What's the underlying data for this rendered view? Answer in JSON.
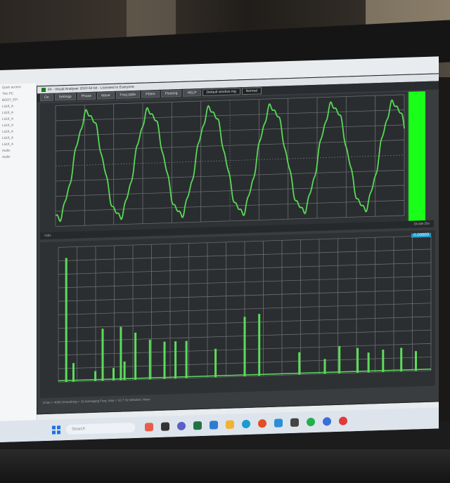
{
  "window": {
    "title": "64 - Visual Analyser 2020 64 bit - Licensed to Everyone"
  },
  "toolbar": {
    "buttons": [
      "On",
      "Settings",
      "Phase",
      "Wave",
      "Freq.table",
      "Filters",
      "Floating",
      "HELP"
    ],
    "window_select": "Default window mg",
    "mode_select": "Normal"
  },
  "explorer": {
    "items": [
      "Quick access",
      "This PC",
      "BOOT_EFI",
      "LS18_A",
      "LS18_A",
      "LS18_A",
      "LS18_A",
      "LS18_A",
      "LS18_A",
      "LS18_A",
      "Audio",
      "Audio"
    ]
  },
  "scope": {
    "status_left": "Vdiv",
    "status_right": "Divide Div"
  },
  "fft": {
    "readout": "0.00000",
    "status": "Chan = 4096  Smoothing = 16  Averaging  Freq. step = 10.7 Hz  Window: Hann"
  },
  "taskbar": {
    "search_placeholder": "Search"
  },
  "chart_data": [
    {
      "type": "line",
      "description_of": "oscilloscope trace",
      "series": [
        {
          "values_periods": 5.7
        }
      ],
      "grid": true
    },
    {
      "type": "bar",
      "grid": true,
      "values": [
        1.0,
        0.15,
        0.08,
        0.42,
        0.1,
        0.43,
        0.15,
        0.38,
        0.32,
        0.3,
        0.3,
        0.3,
        0.23,
        0.48,
        0.5,
        0.18,
        0.12,
        0.22,
        0.2,
        0.16,
        0.18,
        0.19,
        0.16
      ]
    }
  ],
  "colors": {
    "trace": "#58d858",
    "bars": "#5cdc5c",
    "level": "#19ff19",
    "grid": "#6a6e70"
  }
}
